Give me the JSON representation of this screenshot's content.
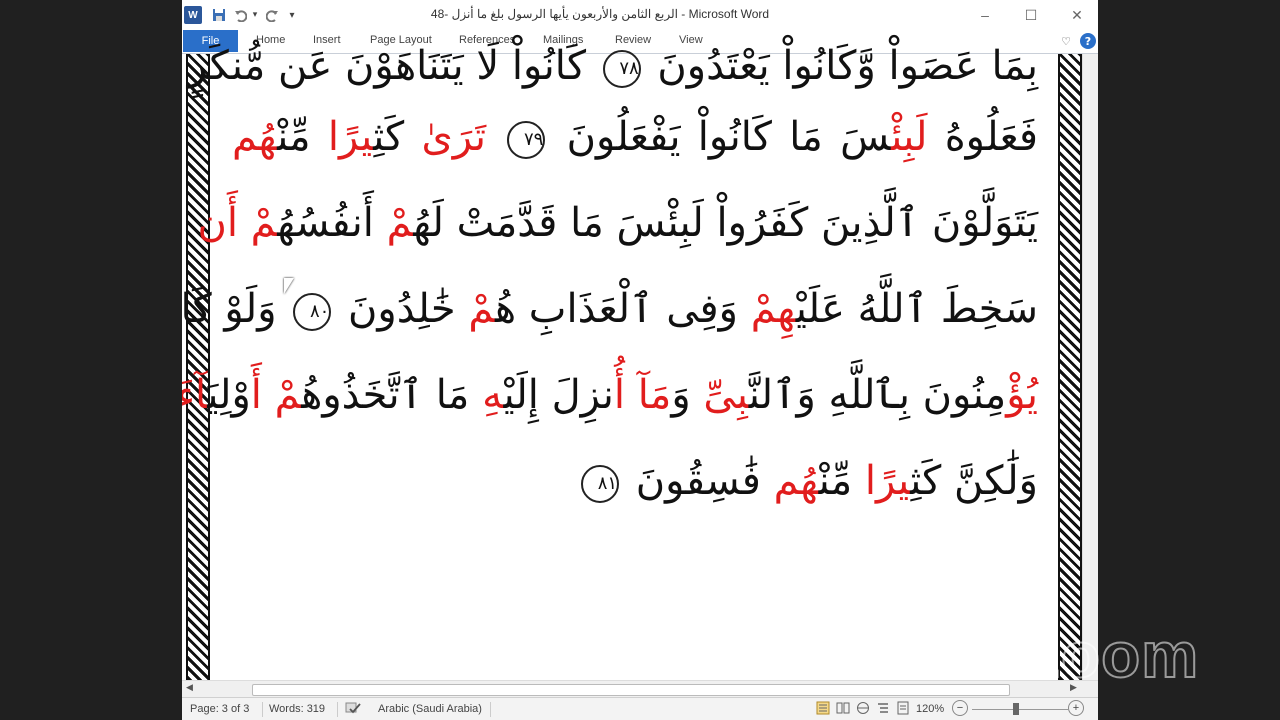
{
  "window": {
    "title": "الربع الثامن والأربعون يأيها الرسول بلغ ما أنزل -48 - Microsoft Word",
    "app_icon": "word-icon",
    "minimize": "–",
    "maximize": "☐",
    "close": "✕"
  },
  "quick_access": {
    "save": "save-icon",
    "undo": "undo-icon",
    "redo": "redo-icon",
    "customize": "▾"
  },
  "ribbon": {
    "tabs": [
      "File",
      "Home",
      "Insert",
      "Page Layout",
      "References",
      "Mailings",
      "Review",
      "View"
    ],
    "collapse_glyph": "♡",
    "help_glyph": "?"
  },
  "document": {
    "lines": [
      [
        {
          "t": "بِمَا عَصَواْ وَّكَانُواْ يَعْتَدُونَ "
        },
        {
          "ayah": "٧٨"
        },
        {
          "t": " كَانُواْ لَا يَتَنَاهَوْنَ عَن مُّنكَرٍ"
        }
      ],
      [
        {
          "t": "فَعَلُوهُ "
        },
        {
          "r": "لَبِئْ"
        },
        {
          "t": "سَ مَا كَانُواْ يَفْعَلُونَ "
        },
        {
          "ayah": "٧٩"
        },
        {
          "t": " "
        },
        {
          "r": "تَرَىٰ"
        },
        {
          "t": " كَثِ"
        },
        {
          "r": "يرًا"
        },
        {
          "t": " مِّن"
        },
        {
          "r": "ْهُم"
        }
      ],
      [
        {
          "t": "يَتَوَلَّوْنَ ٱلَّذِينَ كَفَرُواْ لَبِئْسَ مَا قَدَّمَتْ لَهُ"
        },
        {
          "r": "مْ"
        },
        {
          "t": " أَنفُسُه"
        },
        {
          "r": "ُمْ أَن"
        }
      ],
      [
        {
          "t": "سَخِطَ ٱللَّهُ عَلَيْ"
        },
        {
          "r": "هِمْ"
        },
        {
          "t": " وَفِى ٱلْعَذَابِ هُ"
        },
        {
          "r": "مْ"
        },
        {
          "t": " خَٰلِدُونَ "
        },
        {
          "ayah": "٨٠"
        },
        {
          "t": " وَلَوْ كَانُواْ"
        }
      ],
      [
        {
          "r": "يُؤْ"
        },
        {
          "t": "مِنُونَ بِٱللَّهِ وَٱلنَّ"
        },
        {
          "r": "بِىِّ"
        },
        {
          "t": " وَ"
        },
        {
          "r": "مَآ أُ"
        },
        {
          "t": "نزِلَ إِلَيْ"
        },
        {
          "r": "هِ"
        },
        {
          "t": " مَا ٱتَّخَذُوه"
        },
        {
          "r": "ُمْ أَ"
        },
        {
          "t": "وْلِيَ"
        },
        {
          "r": "آءَ"
        }
      ],
      [
        {
          "t": "وَلَٰكِنَّ كَثِ"
        },
        {
          "r": "يرًا"
        },
        {
          "t": " مِّن"
        },
        {
          "r": "ْهُم"
        },
        {
          "t": " فَٰسِقُونَ "
        },
        {
          "ayah": "٨١"
        }
      ]
    ]
  },
  "status_bar": {
    "page": "Page: 3 of 3",
    "words": "Words: 319",
    "proofing_icon": "proofing-icon",
    "language": "Arabic (Saudi Arabia)",
    "zoom_level": "120%",
    "zoom_out": "−",
    "zoom_in": "+"
  },
  "overlay": {
    "zoom_watermark": "zoom"
  },
  "colors": {
    "accent": "#2a6fc9",
    "tajweed_red": "#e11d1d",
    "background": "#202020"
  }
}
